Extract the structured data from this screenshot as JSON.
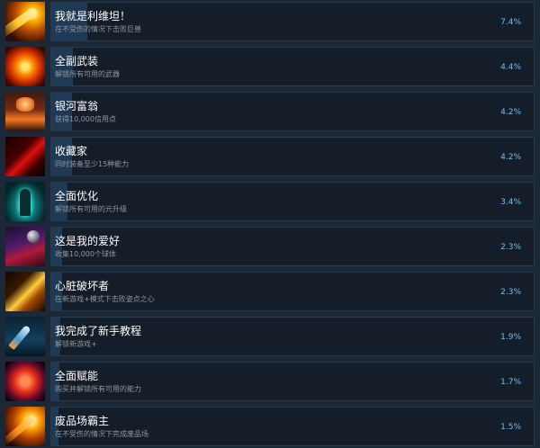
{
  "achievements": [
    {
      "title": "我就是利维坦！",
      "desc": "在不受伤的情况下击败巨兽",
      "percent": "7.4%",
      "progress": 0.074,
      "icon": "comet-fire-icon"
    },
    {
      "title": "全副武装",
      "desc": "解锁所有可用的武器",
      "percent": "4.4%",
      "progress": 0.044,
      "icon": "sun-burst-icon"
    },
    {
      "title": "银河富翁",
      "desc": "获得10,000信用点",
      "percent": "4.2%",
      "progress": 0.042,
      "icon": "mushroom-cloud-icon"
    },
    {
      "title": "收藏家",
      "desc": "同时装备至少15种能力",
      "percent": "4.2%",
      "progress": 0.042,
      "icon": "red-laser-icon"
    },
    {
      "title": "全面优化",
      "desc": "解锁所有可用的元升级",
      "percent": "3.4%",
      "progress": 0.034,
      "icon": "glowing-humanoid-icon"
    },
    {
      "title": "这是我的爱好",
      "desc": "收集10,000个球体",
      "percent": "2.3%",
      "progress": 0.023,
      "icon": "orb-trail-icon"
    },
    {
      "title": "心脏破坏者",
      "desc": "在新游戏+模式下击败姿点之心",
      "percent": "2.3%",
      "progress": 0.023,
      "icon": "explosion-burst-icon"
    },
    {
      "title": "我完成了新手教程",
      "desc": "解锁新游戏+",
      "percent": "1.9%",
      "progress": 0.019,
      "icon": "rocket-icon"
    },
    {
      "title": "全面赋能",
      "desc": "购买并解锁所有可用的能力",
      "percent": "1.7%",
      "progress": 0.017,
      "icon": "red-cell-icon"
    },
    {
      "title": "废品场霸主",
      "desc": "在不受伤的情况下完成废品场",
      "percent": "1.5%",
      "progress": 0.015,
      "icon": "fire-meteor-icon"
    }
  ]
}
